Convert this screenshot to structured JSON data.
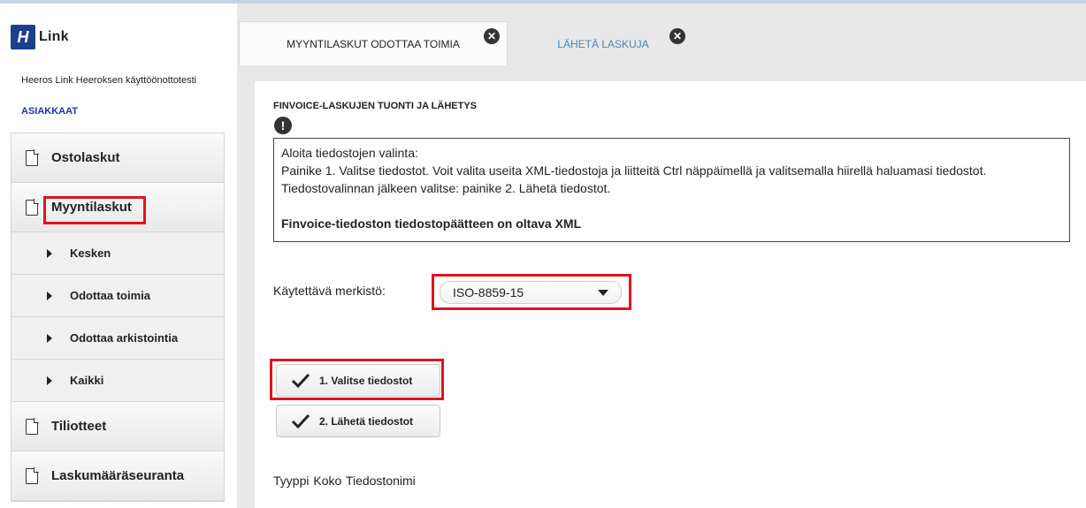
{
  "app": {
    "logo_mark": "H",
    "logo_text": "Link",
    "company": "Heeros Link Heeroksen käyttöönottotesti",
    "customers_link": "ASIAKKAAT"
  },
  "sidebar": {
    "items": [
      {
        "label": "Ostolaskut"
      },
      {
        "label": "Myyntilaskut"
      },
      {
        "label": "Kesken"
      },
      {
        "label": "Odottaa toimia"
      },
      {
        "label": "Odottaa arkistointia"
      },
      {
        "label": "Kaikki"
      },
      {
        "label": "Tiliotteet"
      },
      {
        "label": "Laskumääräseuranta"
      }
    ]
  },
  "tabs": [
    {
      "label": "MYYNTILASKUT ODOTTAA TOIMIA",
      "close": "✕"
    },
    {
      "label": "LÄHETÄ LASKUJA",
      "close": "✕"
    }
  ],
  "main": {
    "title": "FINVOICE-LASKUJEN TUONTI JA LÄHETYS",
    "alert_glyph": "!",
    "info": {
      "line1": "Aloita tiedostojen valinta:",
      "line2": "Painike 1. Valitse tiedostot. Voit valita useita XML-tiedostoja ja liitteitä Ctrl näppäimellä ja valitsemalla hiirellä haluamasi tiedostot.",
      "line3": "Tiedostovalinnan jälkeen valitse: painike 2. Lähetä tiedostot.",
      "note": "Finvoice-tiedoston tiedostopäätteen on oltava XML"
    },
    "charset": {
      "label": "Käytettävä merkistö:",
      "value": "ISO-8859-15"
    },
    "buttons": {
      "select_files": "1. Valitse tiedostot",
      "send_files": "2. Lähetä tiedostot"
    },
    "file_table": {
      "col_type": "Tyyppi",
      "col_size": "Koko",
      "col_name": "Tiedostonimi"
    }
  },
  "colors": {
    "highlight": "#e0141e",
    "link": "#1d2bd0",
    "logo": "#1c3f8f",
    "inactive_tab": "#4a84b9"
  }
}
